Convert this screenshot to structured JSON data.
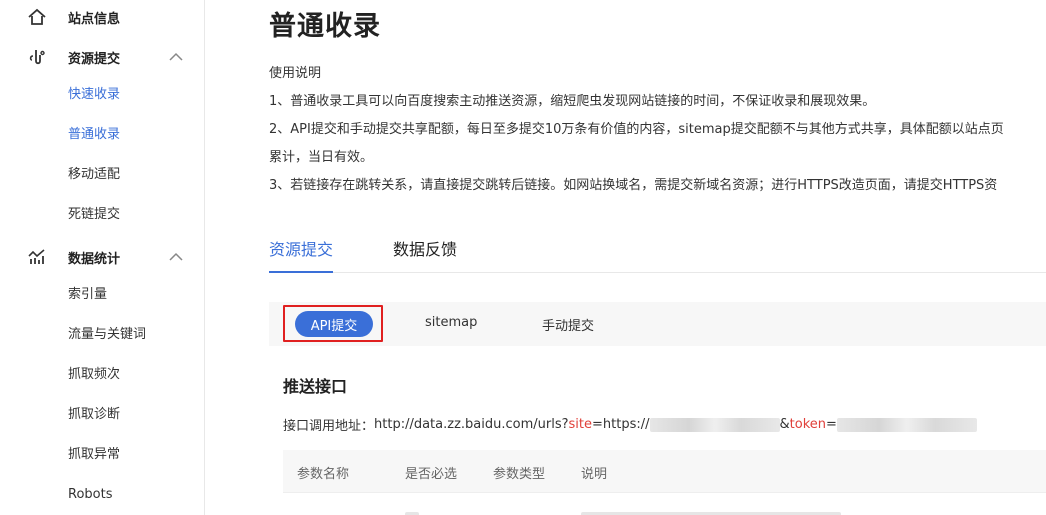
{
  "sidebar": {
    "site_info": "站点信息",
    "resource_submit": {
      "label": "资源提交",
      "items": [
        "快速收录",
        "普通收录",
        "移动适配",
        "死链提交"
      ]
    },
    "data_stats": {
      "label": "数据统计",
      "items": [
        "索引量",
        "流量与关键词",
        "抓取频次",
        "抓取诊断",
        "抓取异常",
        "Robots"
      ]
    }
  },
  "main": {
    "title": "普通收录",
    "usage_heading": "使用说明",
    "intro_lines": [
      "1、普通收录工具可以向百度搜索主动推送资源，缩短爬虫发现网站链接的时间，不保证收录和展现效果。",
      "2、API提交和手动提交共享配额，每日至多提交10万条有价值的内容，sitemap提交配额不与其他方式共享，具体配额以站点页",
      "累计，当日有效。",
      "3、若链接存在跳转关系，请直接提交跳转后链接。如网站换域名，需提交新域名资源；进行HTTPS改造页面，请提交HTTPS资"
    ],
    "tabs": [
      "资源提交",
      "数据反馈"
    ],
    "subtabs": [
      "API提交",
      "sitemap",
      "手动提交"
    ],
    "section_title": "推送接口",
    "endpoint": {
      "label": "接口调用地址：",
      "base": "http://data.zz.baidu.com/urls?",
      "site_key": "site",
      "site_eq": "=https://",
      "token_sep": "&",
      "token_key": "token",
      "token_eq": "="
    },
    "table_headers": [
      "参数名称",
      "是否必选",
      "参数类型",
      "说明"
    ]
  },
  "colors": {
    "accent": "#3a6fd8",
    "highlight": "#e02020",
    "param": "#e0403a"
  }
}
